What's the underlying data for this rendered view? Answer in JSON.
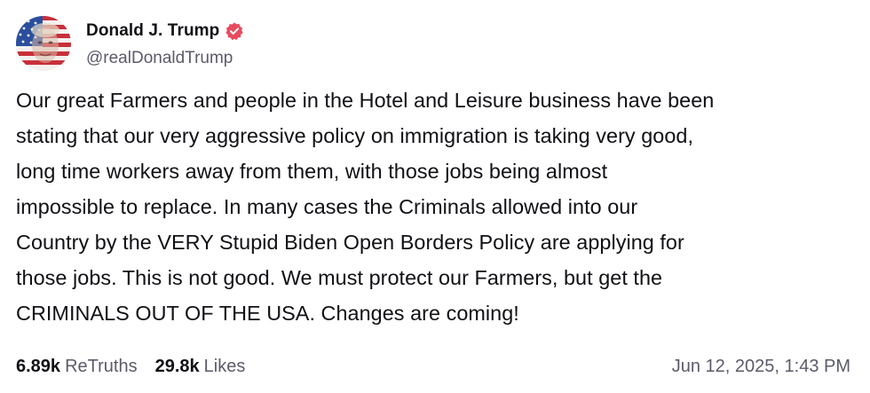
{
  "author": {
    "display_name": "Donald J. Trump",
    "handle": "@realDonaldTrump",
    "verified": true,
    "avatar_icon": "flag-portrait-avatar",
    "verified_icon": "verified-badge-icon",
    "verified_color": "#e84a5f"
  },
  "post": {
    "lines": [
      "Our great Farmers and people in the Hotel and Leisure business have been",
      "stating that our very aggressive policy on immigration is taking very good,",
      "long time workers away from them, with those jobs being almost",
      "impossible to replace. In many cases the Criminals allowed into our",
      "Country by the VERY Stupid Biden Open Borders Policy are applying for",
      "those jobs. This is not good. We must protect our Farmers, but get the",
      "CRIMINALS OUT OF THE USA. Changes are coming!"
    ]
  },
  "stats": {
    "retruths_count": "6.89k",
    "retruths_label": "ReTruths",
    "likes_count": "29.8k",
    "likes_label": "Likes"
  },
  "timestamp": "Jun 12, 2025, 1:43 PM"
}
